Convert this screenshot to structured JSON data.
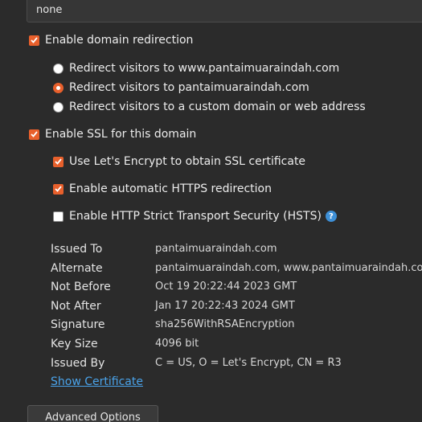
{
  "select": {
    "value": "none"
  },
  "redirection": {
    "label": "Enable domain redirection",
    "checked": true,
    "options": [
      {
        "label": "Redirect visitors to www.pantaimuaraindah.com",
        "selected": false
      },
      {
        "label": "Redirect visitors to pantaimuaraindah.com",
        "selected": true
      },
      {
        "label": "Redirect visitors to a custom domain or web address",
        "selected": false
      }
    ]
  },
  "ssl": {
    "label": "Enable SSL for this domain",
    "checked": true,
    "letsencrypt": {
      "label": "Use Let's Encrypt to obtain SSL certificate",
      "checked": true
    },
    "https_redirect": {
      "label": "Enable automatic HTTPS redirection",
      "checked": true
    },
    "hsts": {
      "label": "Enable HTTP Strict Transport Security (HSTS)",
      "checked": false,
      "help": "?"
    }
  },
  "certificate": {
    "rows": [
      {
        "key": "Issued To",
        "value": "pantaimuaraindah.com"
      },
      {
        "key": "Alternate",
        "value": "pantaimuaraindah.com, www.pantaimuaraindah.com"
      },
      {
        "key": "Not Before",
        "value": "Oct 19 20:22:44 2023 GMT"
      },
      {
        "key": "Not After",
        "value": "Jan 17 20:22:43 2024 GMT"
      },
      {
        "key": "Signature",
        "value": "sha256WithRSAEncryption"
      },
      {
        "key": "Key Size",
        "value": "4096 bit"
      },
      {
        "key": "Issued By",
        "value": "C = US, O = Let's Encrypt, CN = R3"
      }
    ],
    "show_link": "Show Certificate"
  },
  "advanced_button": "Advanced Options",
  "colors": {
    "accent": "#e8602c",
    "link": "#4aa3ea",
    "help": "#3d8fd6",
    "background": "#2b2b2b"
  }
}
